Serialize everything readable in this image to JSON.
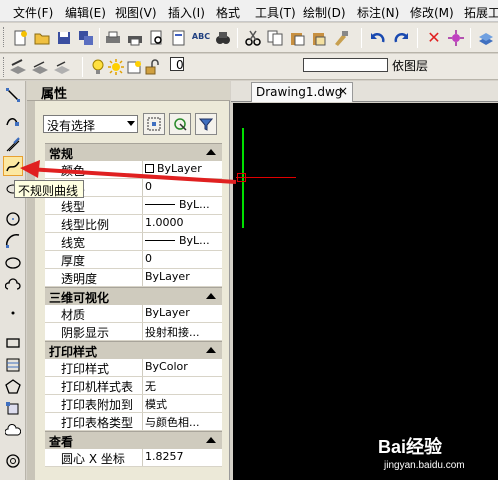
{
  "menu": [
    "文件(F)",
    "编辑(E)",
    "视图(V)",
    "插入(I)",
    "格式",
    "工具(T)",
    "绘制(D)",
    "标注(N)",
    "修改(M)",
    "拓展工"
  ],
  "toolbar2": {
    "layer_value": "0",
    "layer_color": "依图层"
  },
  "properties": {
    "title": "属性",
    "selection": "没有选择",
    "sections": [
      {
        "title": "常规",
        "rows": [
          {
            "key": "颜色",
            "value": "ByLayer"
          },
          {
            "key": "图层",
            "value": "0"
          },
          {
            "key": "线型",
            "value": "ByL..."
          },
          {
            "key": "线型比例",
            "value": "1.0000"
          },
          {
            "key": "线宽",
            "value": "ByL..."
          },
          {
            "key": "厚度",
            "value": "0"
          },
          {
            "key": "透明度",
            "value": "ByLayer"
          }
        ]
      },
      {
        "title": "三维可视化",
        "rows": [
          {
            "key": "材质",
            "value": "ByLayer"
          },
          {
            "key": "阴影显示",
            "value": "投射和接..."
          }
        ]
      },
      {
        "title": "打印样式",
        "rows": [
          {
            "key": "打印样式",
            "value": "ByColor"
          },
          {
            "key": "打印机样式表",
            "value": "无"
          },
          {
            "key": "打印表附加到",
            "value": "模式"
          },
          {
            "key": "打印表格类型",
            "value": "与颜色相..."
          }
        ]
      },
      {
        "title": "查看",
        "rows": [
          {
            "key": "圆心 X 坐标",
            "value": "1.8257"
          }
        ]
      }
    ]
  },
  "tooltip": "不规则曲线",
  "drawing_tab": {
    "label": "Drawing1.dwg",
    "close": "×"
  },
  "watermark": {
    "brand": "Bai经验",
    "url": "jingyan.baidu.com"
  },
  "colors": {
    "canvas": "#000000",
    "y_axis": "#00e000",
    "x_axis": "#e00000",
    "arrow": "#e02020"
  }
}
